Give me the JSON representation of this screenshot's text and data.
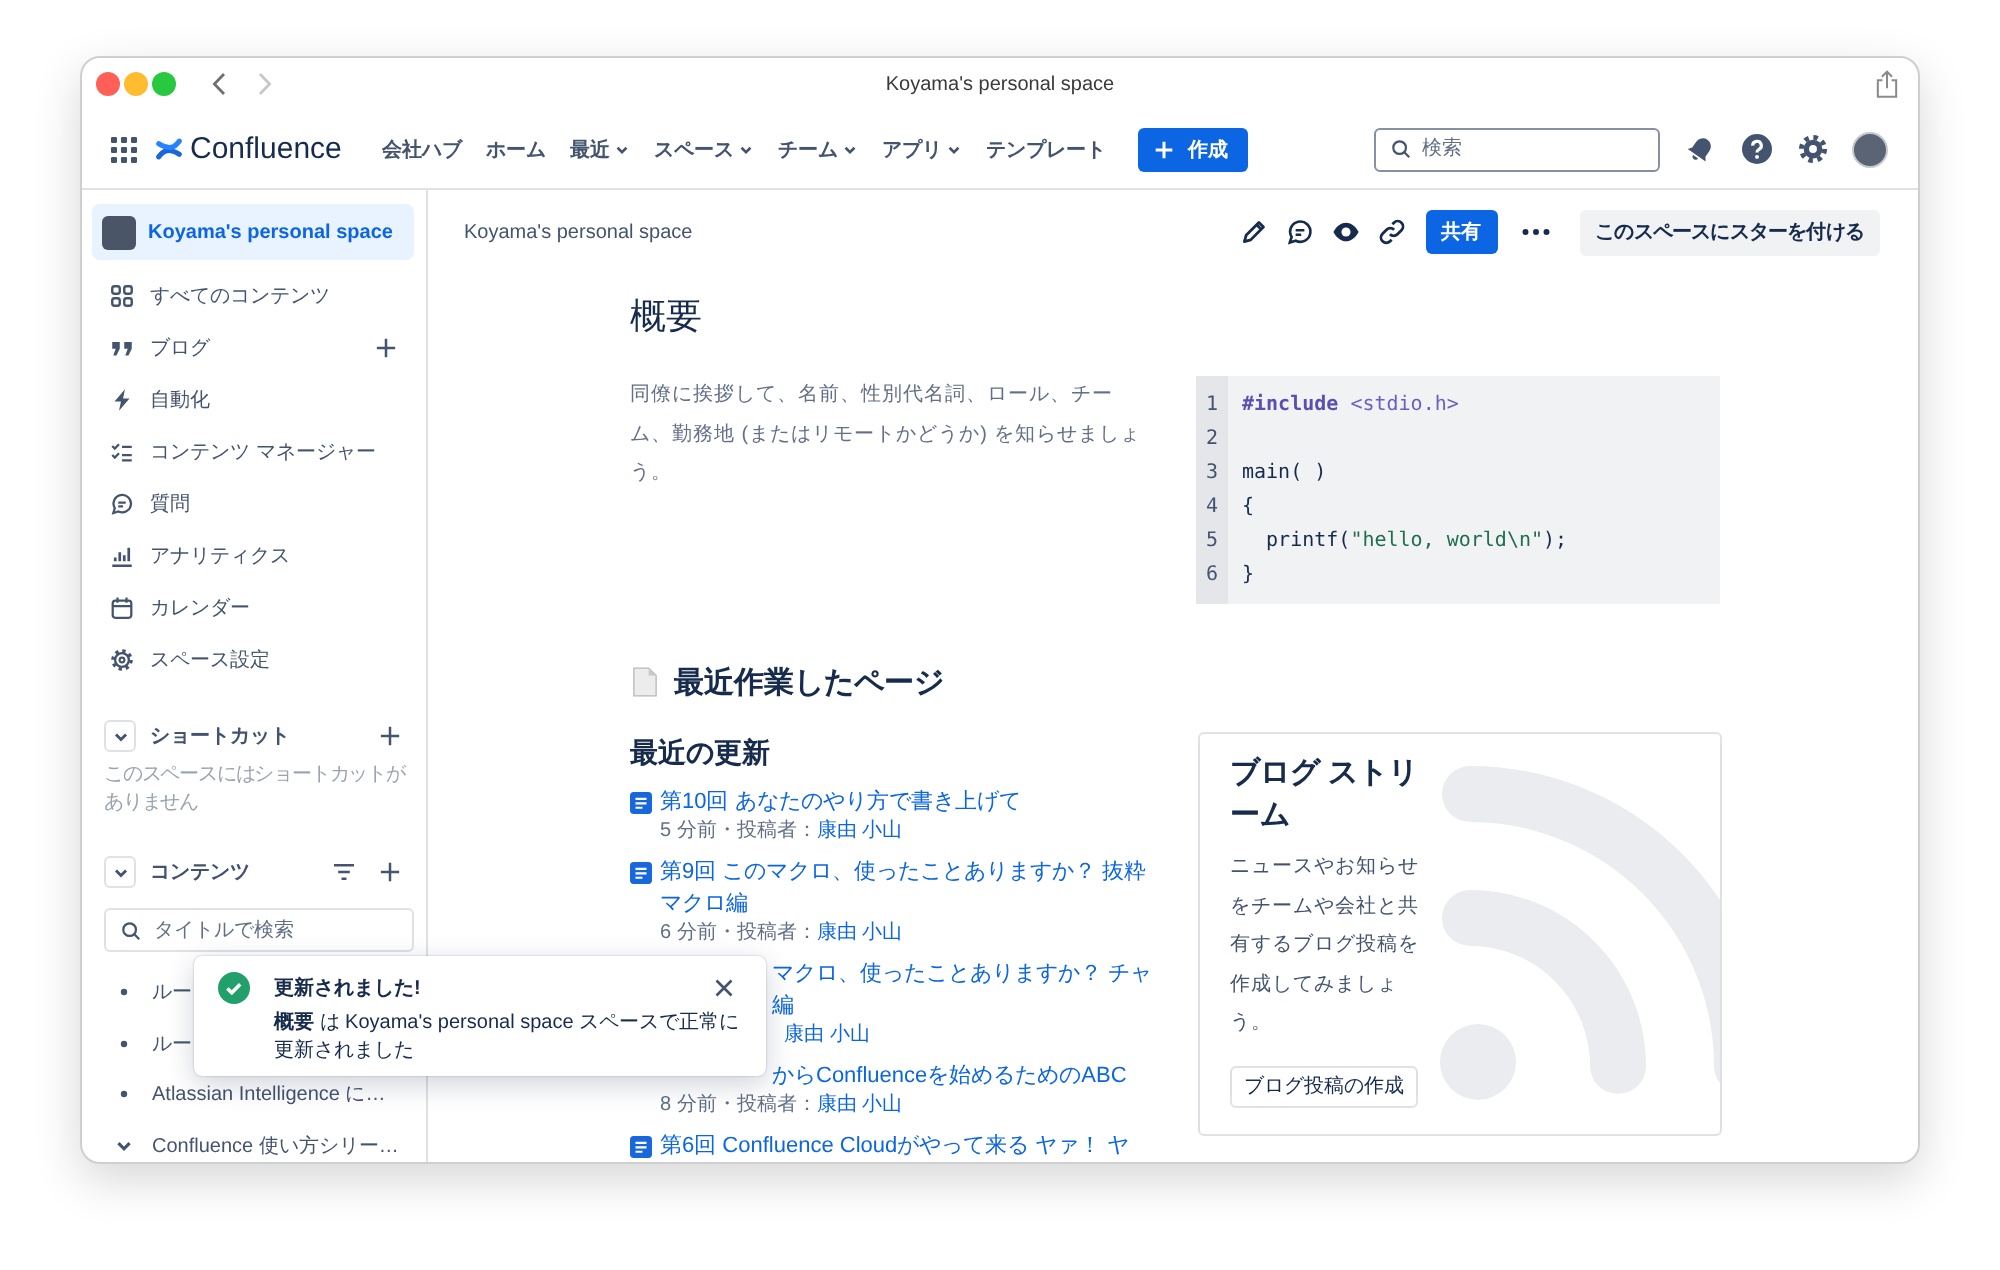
{
  "window": {
    "title": "Koyama's personal space"
  },
  "topnav": {
    "product": "Confluence",
    "items": [
      {
        "label": "会社ハブ",
        "dropdown": false
      },
      {
        "label": "ホーム",
        "dropdown": false
      },
      {
        "label": "最近",
        "dropdown": true
      },
      {
        "label": "スペース",
        "dropdown": true
      },
      {
        "label": "チーム",
        "dropdown": true
      },
      {
        "label": "アプリ",
        "dropdown": true
      },
      {
        "label": "テンプレート",
        "dropdown": false
      }
    ],
    "create_button": "作成",
    "search": {
      "placeholder": "検索"
    }
  },
  "sidebar": {
    "space": {
      "name": "Koyama's personal space",
      "selected": true
    },
    "items": [
      {
        "label": "すべてのコンテンツ",
        "selected": false,
        "add": false
      },
      {
        "label": "ブログ",
        "selected": false,
        "add": true
      },
      {
        "label": "自動化",
        "selected": false,
        "add": false
      },
      {
        "label": "コンテンツ マネージャー",
        "selected": false,
        "add": false
      },
      {
        "label": "質問",
        "selected": false,
        "add": false
      },
      {
        "label": "アナリティクス",
        "selected": false,
        "add": false
      },
      {
        "label": "カレンダー",
        "selected": false,
        "add": false
      },
      {
        "label": "スペース設定",
        "selected": false,
        "add": false
      }
    ],
    "shortcuts": {
      "title": "ショートカット",
      "expanded": true,
      "empty_text": "このスペースにはショートカットがありません"
    },
    "content": {
      "title": "コンテンツ",
      "expanded": true,
      "search": {
        "placeholder": "タイトルで検索"
      },
      "tree": [
        {
          "label": "ルー",
          "kind": "page"
        },
        {
          "label": "ルー",
          "kind": "page"
        },
        {
          "label": "Atlassian Intelligence に…",
          "kind": "page"
        },
        {
          "label": "Confluence 使い方シリー…",
          "kind": "parent"
        }
      ]
    }
  },
  "page_header": {
    "breadcrumb": "Koyama's personal space",
    "share_button": "共有",
    "star_button": "このスペースにスターを付ける"
  },
  "page": {
    "title": "概要",
    "intro": "同僚に挨拶して、名前、性別代名詞、ロール、チーム、勤務地 (またはリモートかどうか) を知らせましょう。",
    "code": [
      {
        "number": "1",
        "tokens": [
          {
            "kind": "keyword",
            "text": "#include"
          },
          {
            "kind": "header",
            "text": " <stdio.h>"
          }
        ]
      },
      {
        "number": "2"
      },
      {
        "number": "3",
        "tokens": [
          {
            "kind": "plain",
            "text": "main( )"
          }
        ]
      },
      {
        "number": "4",
        "tokens": [
          {
            "kind": "plain",
            "text": "{"
          }
        ]
      },
      {
        "number": "5",
        "tokens": [
          {
            "kind": "plain",
            "text": "  printf("
          },
          {
            "kind": "string",
            "text": "\"hello, world\\n\""
          },
          {
            "kind": "plain",
            "text": ");"
          }
        ]
      },
      {
        "number": "6",
        "tokens": [
          {
            "kind": "plain",
            "text": "}"
          }
        ]
      }
    ],
    "recent_heading": "最近作業したページ",
    "updates": {
      "title": "最近の更新",
      "items": [
        {
          "kind": "full",
          "title": [
            "第10回 あなたのやり方で書き上げて"
          ],
          "meta": "5 分前・投稿者：",
          "author": "康由 小山"
        },
        {
          "kind": "full",
          "title": [
            "第9回 このマクロ、使ったことありますか？ 抜粋",
            "マクロ編"
          ],
          "meta": "6 分前・投稿者：",
          "author": "康由 小山"
        },
        {
          "kind": "covered",
          "title": [
            "マクロ、使ったことありますか？ チャ",
            "編"
          ],
          "author": "康由 小山"
        },
        {
          "kind": "covered",
          "title": [
            "からConfluenceを始めるためのABC"
          ],
          "meta": "8 分前・投稿者：",
          "author": "康由 小山"
        },
        {
          "kind": "full",
          "title": [
            "第6回 Confluence Cloudがやって来る ヤァ！ ヤ"
          ]
        }
      ]
    },
    "blog": {
      "title": "ブログ ストリーム",
      "text": "ニュースやお知らせをチームや会社と共有するブログ投稿を作成してみましょう。",
      "button": "ブログ投稿の作成"
    }
  },
  "toast": {
    "title": "更新されました!",
    "message": "**概要** は Koyama's personal space スペースで正常に更新されました"
  }
}
